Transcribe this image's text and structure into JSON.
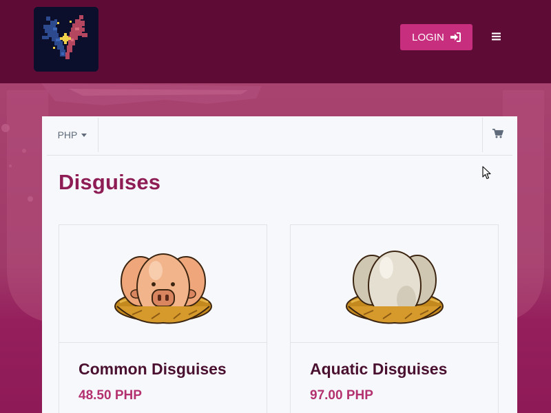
{
  "header": {
    "login_label": "LOGIN",
    "login_icon": "sign-in-icon",
    "menu_icon": "hamburger-menu-icon"
  },
  "toolbar": {
    "currency": "PHP",
    "currency_icon": "caret-down-icon",
    "cart_icon": "shopping-cart-icon"
  },
  "main": {
    "title": "Disguises",
    "products": [
      {
        "name": "Common Disguises",
        "price": "48.50 PHP",
        "image_icon": "pig-eggs-nest-icon"
      },
      {
        "name": "Aquatic Disguises",
        "price": "97.00 PHP",
        "image_icon": "white-eggs-nest-icon"
      }
    ]
  },
  "colors": {
    "header_bg": "#5e0b36",
    "accent": "#c72e7e",
    "title": "#8e1d56",
    "price": "#b3316f"
  }
}
